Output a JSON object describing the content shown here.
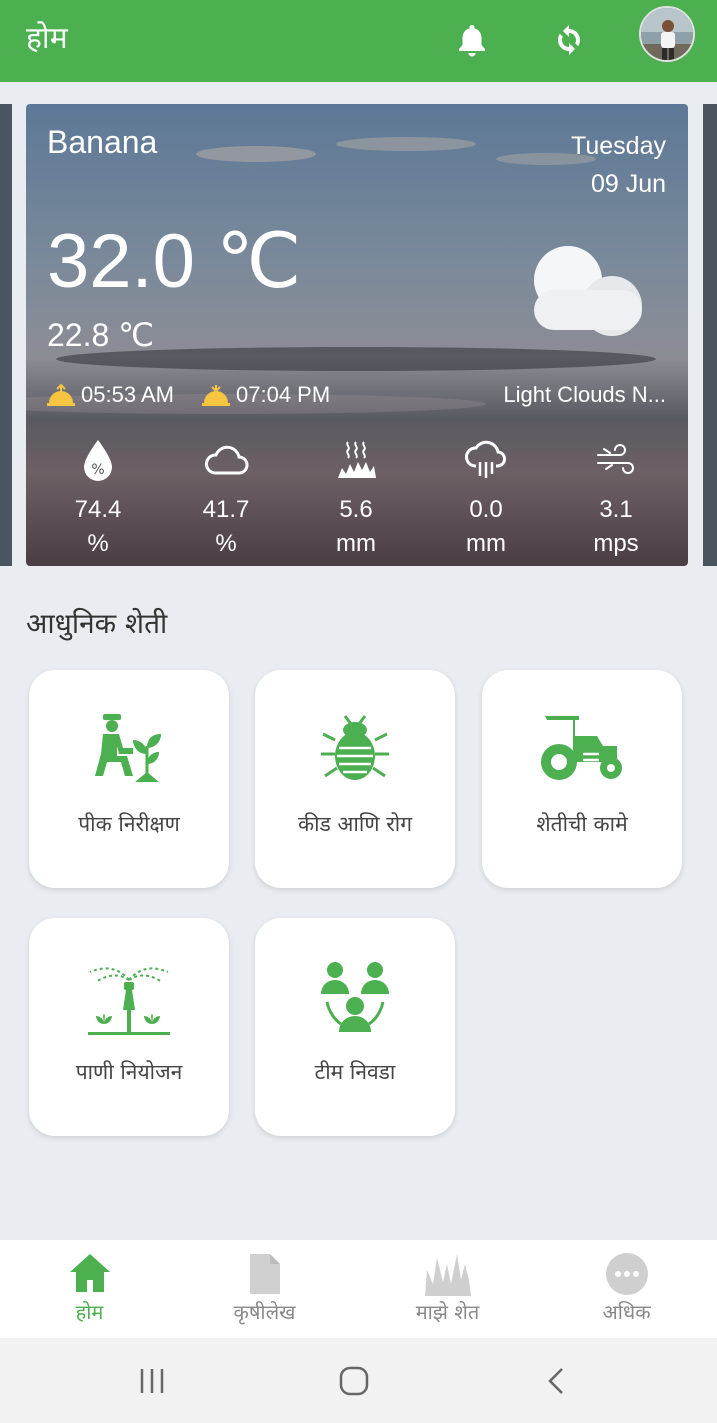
{
  "appbar": {
    "title": "होम",
    "icons": [
      "bell-icon",
      "sync-icon",
      "profile-avatar"
    ]
  },
  "weather": {
    "crop": "Banana",
    "day": "Tuesday",
    "date": "09 Jun",
    "temp_max": "32.0 ℃",
    "temp_min": "22.8 ℃",
    "sunrise": "05:53 AM",
    "sunset": "07:04 PM",
    "description": "Light Clouds N...",
    "condition_icon": "moon-cloud-icon",
    "stats": [
      {
        "icon": "humidity-icon",
        "value": "74.4",
        "unit": "%"
      },
      {
        "icon": "cloud-icon",
        "value": "41.7",
        "unit": "%"
      },
      {
        "icon": "evaporation-icon",
        "value": "5.6",
        "unit": "mm"
      },
      {
        "icon": "rain-icon",
        "value": "0.0",
        "unit": "mm"
      },
      {
        "icon": "wind-icon",
        "value": "3.1",
        "unit": "mps"
      }
    ]
  },
  "section": {
    "title": "आधुनिक शेती"
  },
  "tiles": [
    {
      "label": "पीक निरीक्षण",
      "icon": "farmer-plant-icon"
    },
    {
      "label": "कीड आणि रोग",
      "icon": "pest-bug-icon"
    },
    {
      "label": "शेतीची कामे",
      "icon": "tractor-icon"
    },
    {
      "label": "पाणी नियोजन",
      "icon": "sprinkler-icon"
    },
    {
      "label": "टीम निवडा",
      "icon": "team-icon"
    }
  ],
  "bottom_nav": [
    {
      "label": "होम",
      "icon": "home-icon",
      "active": true
    },
    {
      "label": "कृषीलेख",
      "icon": "document-icon",
      "active": false
    },
    {
      "label": "माझे शेत",
      "icon": "farm-grass-icon",
      "active": false
    },
    {
      "label": "अधिक",
      "icon": "more-icon",
      "active": false
    }
  ],
  "colors": {
    "primary": "#4caf50",
    "background": "#e9edf1",
    "tile": "#ffffff",
    "inactive": "#bdbdbd"
  }
}
